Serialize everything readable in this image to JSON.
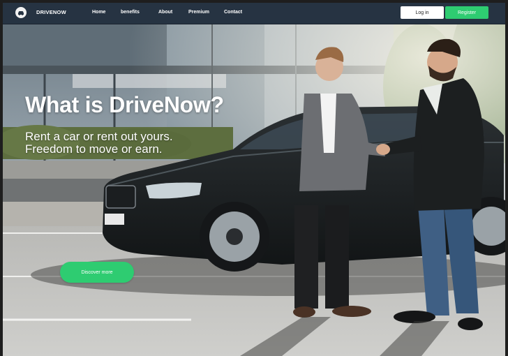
{
  "nav": {
    "brand": "DRIVENOW",
    "links": [
      "Home",
      "benefits",
      "About",
      "Premium",
      "Contact"
    ],
    "login_label": "Log in",
    "register_label": "Register"
  },
  "hero": {
    "headline": "What is DriveNow?",
    "tagline_line1": "Rent a car or rent out yours.",
    "tagline_line2": "Freedom to move or earn.",
    "cta_label": "Discover more"
  },
  "colors": {
    "navbar": "#263342",
    "accent_green": "#2ecc71",
    "login_bg": "#ffffff"
  },
  "icons": {
    "logo": "car-logo-icon"
  }
}
